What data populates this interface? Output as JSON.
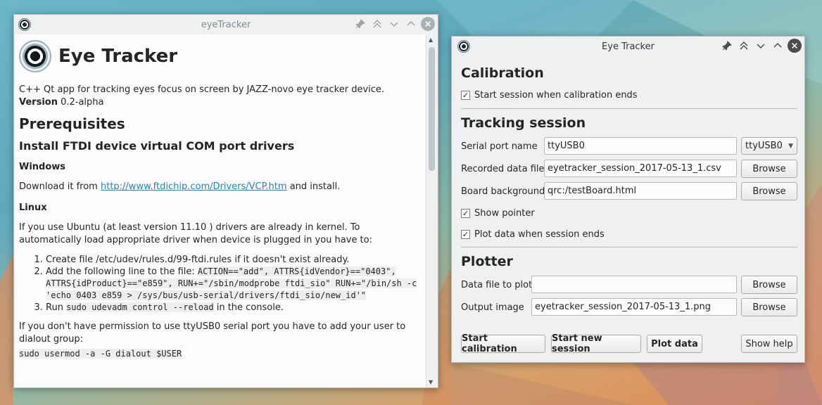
{
  "help_window": {
    "title": "eyeTracker",
    "heading": "Eye Tracker",
    "intro": "C++ Qt app for tracking eyes focus on screen by JAZZ-novo eye tracker device.",
    "version_label": "Version",
    "version_value": " 0.2-alpha",
    "prerequisites": "Prerequisites",
    "install_heading": "Install FTDI device virtual COM port drivers",
    "windows_heading": "Windows",
    "windows_text_before": "Download it from ",
    "windows_link": "http://www.ftdichip.com/Drivers/VCP.htm",
    "windows_text_after": " and install.",
    "linux_heading": "Linux",
    "linux_text": "If you use Ubuntu (at least version 11.10 ) drivers are already in kernel. To automatically load appropriate driver when device is plugged in you have to:",
    "steps": {
      "s1": "Create file /etc/udev/rules.d/99-ftdi.rules if it doesn't exist already.",
      "s2_prefix": "Add the following line to the file: ",
      "s2_code": "ACTION==\"add\", ATTRS{idVendor}==\"0403\", ATTRS{idProduct}==\"e859\", RUN+=\"/sbin/modprobe ftdi_sio\" RUN+=\"/bin/sh -c 'echo 0403 e859 > /sys/bus/usb-serial/drivers/ftdi_sio/new_id'\"",
      "s3_prefix": "Run ",
      "s3_code": "sudo udevadm control --reload",
      "s3_suffix": " in the console."
    },
    "permission_text": "If you don't have permission to use ttyUSB0 serial port you have to add your user to dialout group:",
    "permission_code": "sudo usermod -a -G dialout $USER"
  },
  "main_window": {
    "title": "Eye Tracker",
    "calibration": {
      "title": "Calibration",
      "start_session_checkbox": "Start session when calibration ends"
    },
    "tracking": {
      "title": "Tracking session",
      "serial_port_label": "Serial port name",
      "serial_port_value": "ttyUSB0",
      "serial_port_combo": "ttyUSB0",
      "recorded_label": "Recorded data file",
      "recorded_value": "eyetracker_session_2017-05-13_1.csv",
      "board_label": "Board background",
      "board_value": "qrc:/testBoard.html",
      "browse": "Browse",
      "show_pointer": "Show pointer",
      "plot_when_ends": "Plot data when session ends"
    },
    "plotter": {
      "title": "Plotter",
      "data_file_label": "Data file to plot",
      "data_file_value": "",
      "output_label": "Output image",
      "output_value": "eyetracker_session_2017-05-13_1.png",
      "browse": "Browse"
    },
    "buttons": {
      "start_calibration": "Start calibration",
      "start_new_session": "Start new session",
      "plot_data": "Plot data",
      "show_help": "Show help"
    }
  }
}
